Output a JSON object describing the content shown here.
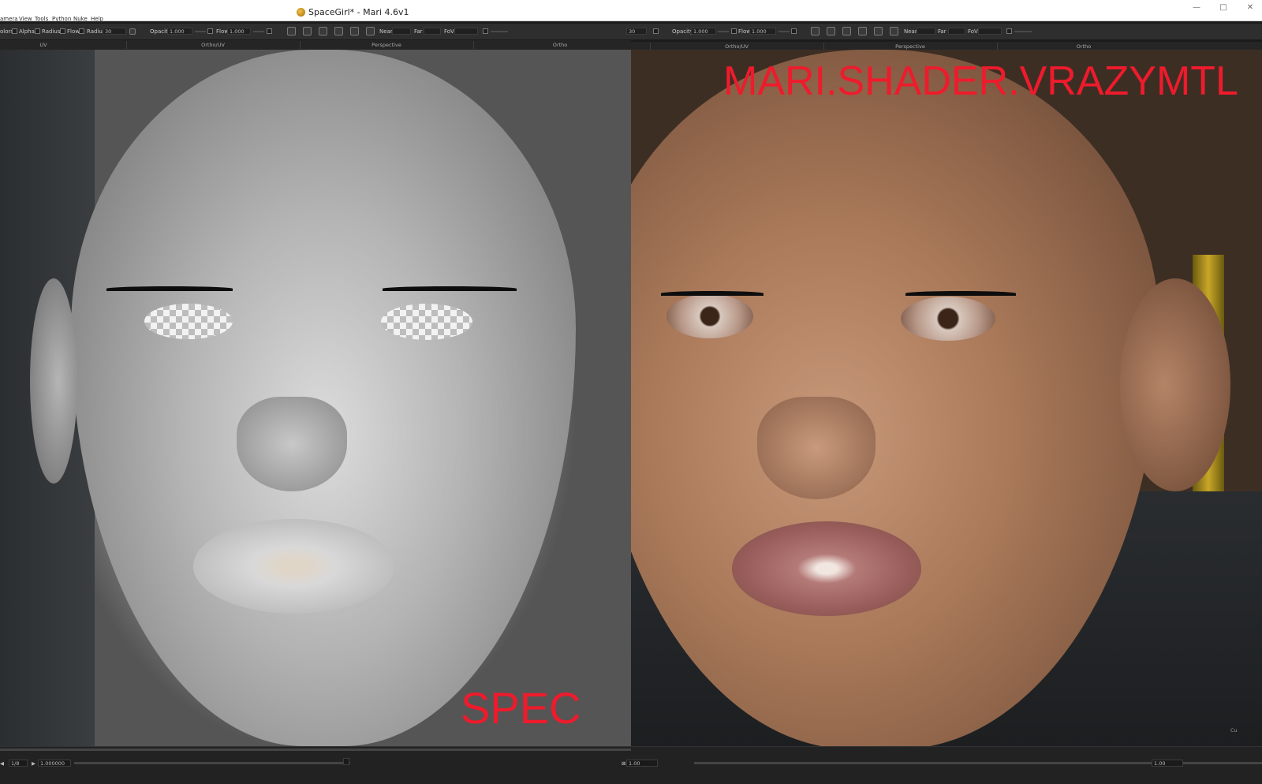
{
  "window": {
    "title": "SpaceGirl* - Mari 4.6v1",
    "controls": [
      "—",
      "□",
      "✕"
    ]
  },
  "menu": [
    "amera",
    "View",
    "Tools",
    "Python",
    "Nuke",
    "Help"
  ],
  "left_toolbar": {
    "labels": [
      "olors",
      "Alpha",
      "Radius",
      "Flow",
      "Radius",
      "Opacity",
      "Flow",
      "Near",
      "Far",
      "FoV"
    ],
    "radius_value": "30",
    "opacity_value": "1.000",
    "flow_value": "1.000"
  },
  "right_toolbar": {
    "radius_value": "30",
    "opacity_label": "Opacity",
    "opacity_value": "1.000",
    "flow_label": "Flow",
    "flow_value": "1.000",
    "near_label": "Near",
    "far_label": "Far",
    "fov_label": "FoV"
  },
  "left_tabs": [
    "UV",
    "Ortho/UV",
    "Perspective",
    "Ortho"
  ],
  "right_tabs": [
    "Ortho/UV",
    "Perspective",
    "Ortho"
  ],
  "overlays": {
    "left_label": "SPEC",
    "right_label": "MARI.SHADER.VRAZYMTL"
  },
  "statusbar": {
    "frame": "1/8",
    "time_value": "1.000000",
    "left_zoom": "1.00",
    "right_zoom": "1.00",
    "corner": "Cu"
  },
  "colors": {
    "overlay_red": "#ee1b2c",
    "toolbar_bg": "#2e2e2e"
  }
}
